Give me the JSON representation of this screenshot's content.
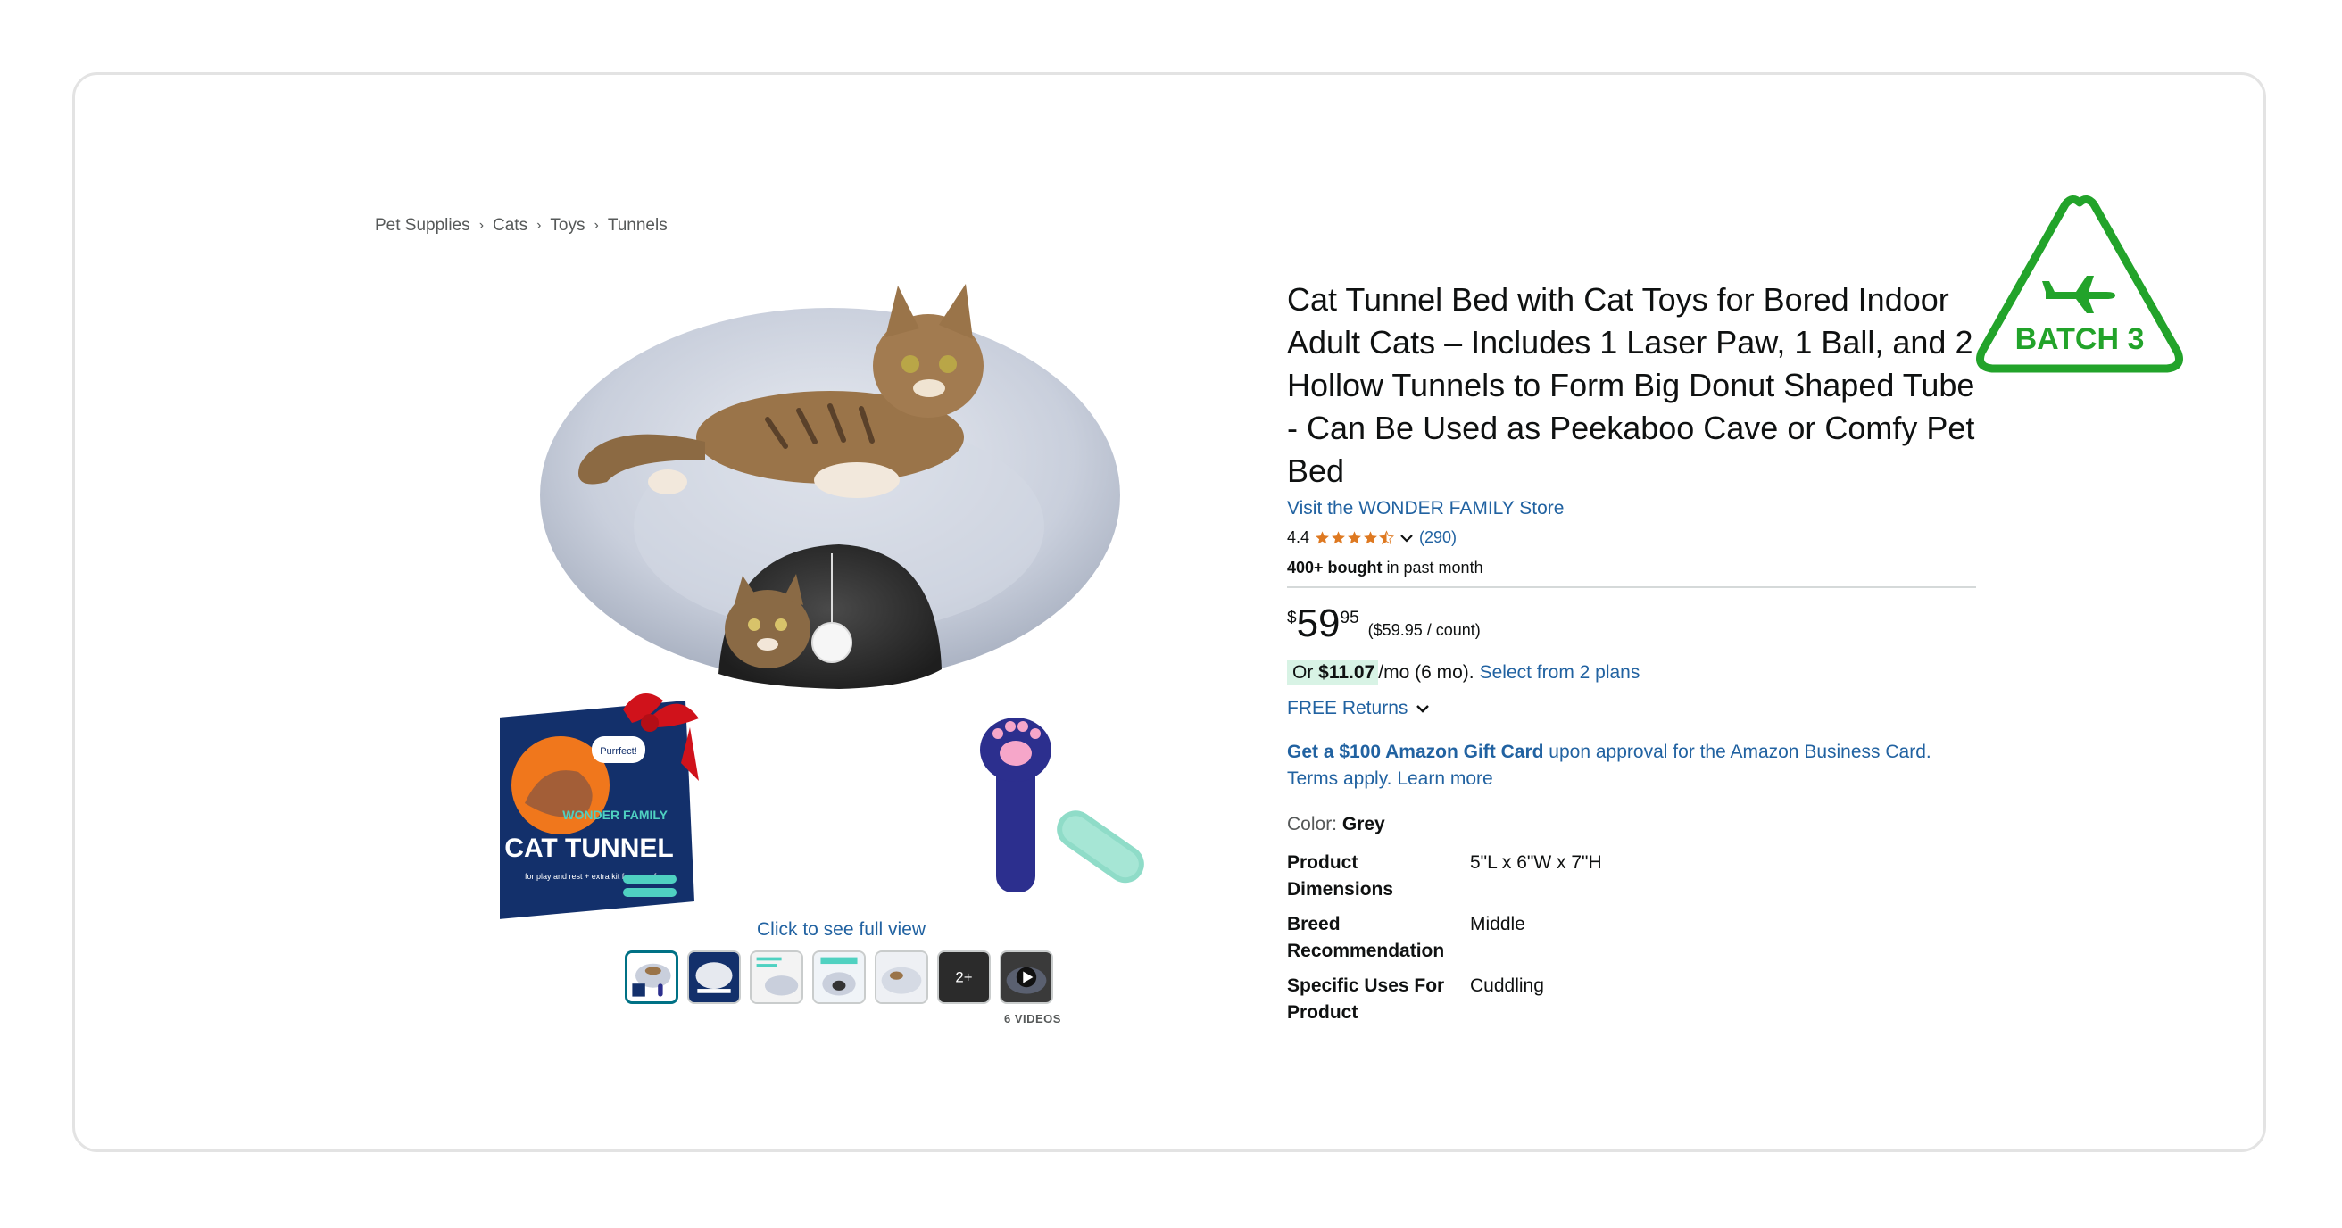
{
  "breadcrumb": [
    "Pet Supplies",
    "Cats",
    "Toys",
    "Tunnels"
  ],
  "breadcrumb_separator": "›",
  "product": {
    "title": "Cat Tunnel Bed with Cat Toys for Bored Indoor Adult Cats – Includes 1 Laser Paw, 1 Ball, and 2 Hollow Tunnels to Form Big Donut Shaped Tube - Can Be Used as Peekaboo Cave or Comfy Pet Bed",
    "store_link": "Visit the WONDER FAMILY Store",
    "rating": "4.4",
    "rating_stars": 4.4,
    "ratings_count": "(290)",
    "bought_bold": "400+ bought",
    "bought_rest": " in past month"
  },
  "box_art": {
    "brand": "WONDER FAMILY",
    "name": "CAT TUNNEL",
    "tagline": "for play and rest + extra kit for more fun",
    "bubble": "Purrfect!"
  },
  "price": {
    "symbol": "$",
    "whole": "59",
    "fraction": "95",
    "unit": "($59.95 / count)"
  },
  "monthly": {
    "or": "Or ",
    "amount": "$11.07",
    "rest": " /mo (6 mo).",
    "plans_link": "Select from 2 plans"
  },
  "returns": "FREE Returns",
  "gift": {
    "bold": "Get a $100 Amazon Gift Card",
    "rest": " upon approval for the Amazon Business Card.",
    "terms": "Terms apply. Learn more"
  },
  "color": {
    "label": "Color: ",
    "value": "Grey"
  },
  "specs": [
    {
      "key_line1": "Product",
      "key_line2": "Dimensions",
      "value": "5\"L x 6\"W x 7\"H"
    },
    {
      "key_line1": "Breed",
      "key_line2": "Recommendation",
      "value": "Middle"
    },
    {
      "key_line1": "Specific Uses For",
      "key_line2": "Product",
      "value": "Cuddling"
    }
  ],
  "gallery": {
    "see_full_view": "Click to see full view",
    "more_thumbs": "2+",
    "videos_label": "6 VIDEOS"
  },
  "badge": {
    "text": "BATCH 3",
    "color": "#22a32a",
    "icon": "airplane-icon"
  },
  "colors": {
    "link": "#2162a1",
    "star": "#de7921",
    "highlight": "#d8f3e5"
  }
}
